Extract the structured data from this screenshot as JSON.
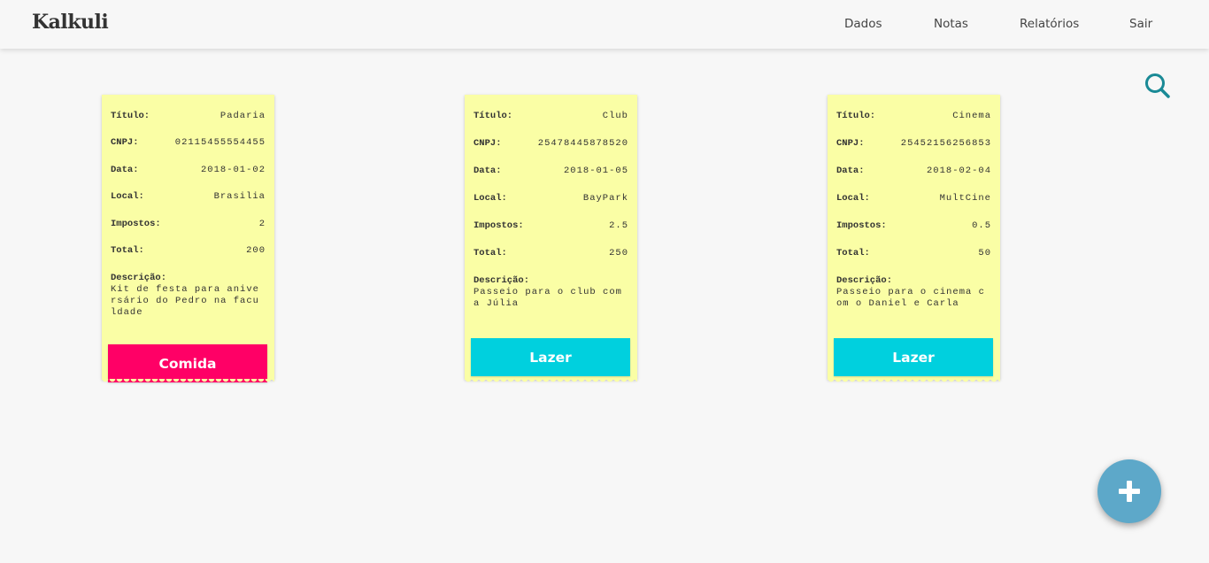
{
  "brand": "Kalkuli",
  "nav": {
    "dados": "Dados",
    "notas": "Notas",
    "relatorios": "Relatórios",
    "sair": "Sair"
  },
  "labels": {
    "titulo": "Título:",
    "cnpj": "CNPJ:",
    "data": "Data:",
    "local": "Local:",
    "impostos": "Impostos:",
    "total": "Total:",
    "descricao": "Descrição:"
  },
  "receipts": [
    {
      "titulo": "Padaria",
      "cnpj": "02115455554455",
      "data": "2018-01-02",
      "local": "Brasilia",
      "impostos": "2",
      "total": "200",
      "descricao": "Kit de festa para aniversário do Pedro na faculdade",
      "tag": "Comida",
      "tag_color": "#ff0066"
    },
    {
      "titulo": "Club",
      "cnpj": "25478445878520",
      "data": "2018-01-05",
      "local": "BayPark",
      "impostos": "2.5",
      "total": "250",
      "descricao": "Passeio para o club com a Júlia",
      "tag": "Lazer",
      "tag_color": "#00d0de"
    },
    {
      "titulo": "Cinema",
      "cnpj": "25452156256853",
      "data": "2018-02-04",
      "local": "MultCine",
      "impostos": "0.5",
      "total": "50",
      "descricao": "Passeio para o cinema com o Daniel e Carla",
      "tag": "Lazer",
      "tag_color": "#00d0de"
    }
  ],
  "icons": {
    "search": "search-icon",
    "add": "plus-icon"
  },
  "colors": {
    "receipt_bg": "#fafea5",
    "search_icon": "#1a8a96",
    "fab_bg": "#5da8c9"
  }
}
